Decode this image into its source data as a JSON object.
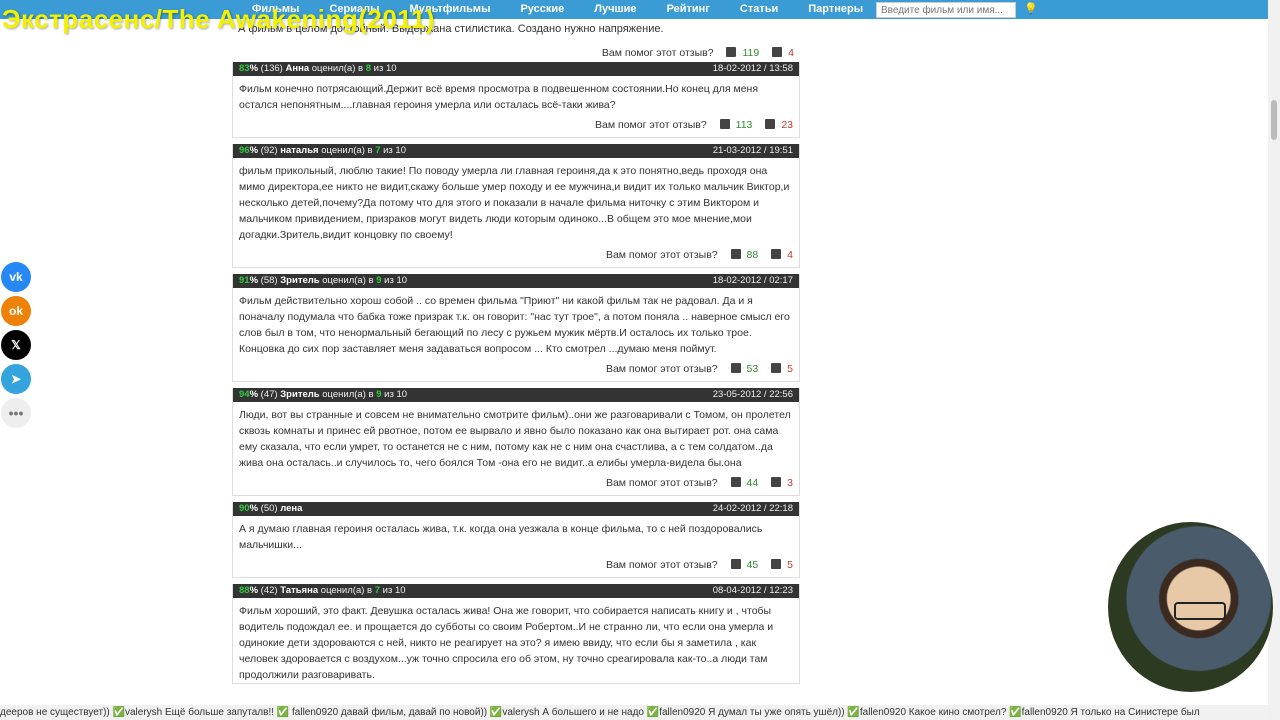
{
  "page_title": "Экстрасенс/The Awakening(2011)",
  "nav": {
    "items": [
      "Фильмы",
      "Сериалы",
      "Мультфильмы",
      "Русские",
      "Лучшие",
      "Рейтинг",
      "Статьи",
      "Партнеры"
    ],
    "search_placeholder": "Введите фильм или имя..."
  },
  "cut_review": {
    "text": "А фильм в целом достойный. Выдержана стилистика. Создано нужно напряжение.",
    "helpful_label": "Вам помог этот отзыв?",
    "up": "119",
    "down": "4"
  },
  "reviews": [
    {
      "pct": "83",
      "count": "(136)",
      "name": "Анна",
      "rated": "оценил(а) в",
      "score": "8",
      "of": "из 10",
      "date": "18-02-2012 / 13:58",
      "text": "Фильм конечно потрясающий.Держит всё время просмотра в подвешенном состоянии.Но конец для меня остался непонятным....главная героиня умерла или осталась всё-таки жива?",
      "helpful_label": "Вам помог этот отзыв?",
      "up": "113",
      "down": "23"
    },
    {
      "pct": "96",
      "count": "(92)",
      "name": "наталья",
      "rated": "оценил(а) в",
      "score": "7",
      "of": "из 10",
      "date": "21-03-2012 / 19:51",
      "text": "фильм прикольный, люблю такие! По поводу умерла ли главная героиня,да к это понятно,ведь проходя она мимо директора,ее никто не видит,скажу больше умер походу и ее мужчина,и видит их только мальчик Виктор,и несколько детей,почему?Да потому что для этого и показали в начале фильма ниточку с этим Виктором и мальчиком привидением, призраков могут видеть люди которым одиноко...В общем это мое мнение,мои догадки.Зритель,видит концовку по своему!",
      "helpful_label": "Вам помог этот отзыв?",
      "up": "88",
      "down": "4"
    },
    {
      "pct": "91",
      "count": "(58)",
      "name": "Зритель",
      "rated": "оценил(а) в",
      "score": "9",
      "of": "из 10",
      "date": "18-02-2012 / 02:17",
      "text": "Фильм действительно хорош собой .. со времен фильма \"Приют\" ни какой фильм так не радовал. Да и я поначалу подумала что бабка тоже призрак т.к. он говорит: \"нас тут трое\", а потом поняла .. наверное смысл его слов был в том, что ненормальный бегающий по лесу с ружьем мужик мёртв.И осталось их только трое. Концовка до сих пор заставляет меня задаваться вопросом ... Кто смотрел ...думаю меня поймут.",
      "helpful_label": "Вам помог этот отзыв?",
      "up": "53",
      "down": "5"
    },
    {
      "pct": "94",
      "count": "(47)",
      "name": "Зритель",
      "rated": "оценил(а) в",
      "score": "9",
      "of": "из 10",
      "date": "23-05-2012 / 22:56",
      "text": "Люди, вот вы странные и совсем не внимательно смотрите фильм)..они же разговаривали с Томом, он пролетел сквозь комнаты и принес ей рвотное, потом ее вырвало и явно было показано как она вытирает рот. она сама ему сказала, что если умрет, то останется не с ним, потому как не с ним она счастлива, а с тем солдатом..да жива она осталась..и случилось то, чего боялся Том -она его не видит..а елибы умерла-видела бы.она",
      "helpful_label": "Вам помог этот отзыв?",
      "up": "44",
      "down": "3"
    },
    {
      "pct": "90",
      "count": "(50)",
      "name": "лена",
      "rated": "",
      "score": "",
      "of": "",
      "date": "24-02-2012 / 22:18",
      "text": "А я думаю главная героиня осталась жива, т.к. когда она уезжала в конце фильма, то с ней поздоровались мальчишки...",
      "helpful_label": "Вам помог этот отзыв?",
      "up": "45",
      "down": "5"
    },
    {
      "pct": "88",
      "count": "(42)",
      "name": "Татьяна",
      "rated": "оценил(а) в",
      "score": "7",
      "of": "из 10",
      "date": "08-04-2012 / 12:23",
      "text": "Фильм хороший, это факт. Девушка осталась жива! Она же говорит, что собирается написать книгу и , чтобы водитель подождал ее. и прощается до субботы со своим Робертом..И не странно ли, что если она умерла и одинокие дети здороваются с ней, никто не реагирует на это? я имею ввиду, что если бы я заметила , как человек здоровается с воздухом...уж точно спросила его об этом, ну точно среагировала как-то..а люди там продолжили разговаривать.",
      "helpful_label": "",
      "up": "",
      "down": ""
    }
  ],
  "social": [
    "vk-icon",
    "ok-icon",
    "x-icon",
    "telegram-icon",
    "more-icon"
  ],
  "ticker": "дееров не существует)) ✅valerysh Ещё больше запуталв!! ✅ fallen0920 давай фильм, давай по новой)) ✅valerysh А большего и не надо ✅fallen0920 Я думал ты уже опять ушёл)) ✅fallen0920 Какое кино смотрел? ✅fallen0920 Я только на Синистере был"
}
